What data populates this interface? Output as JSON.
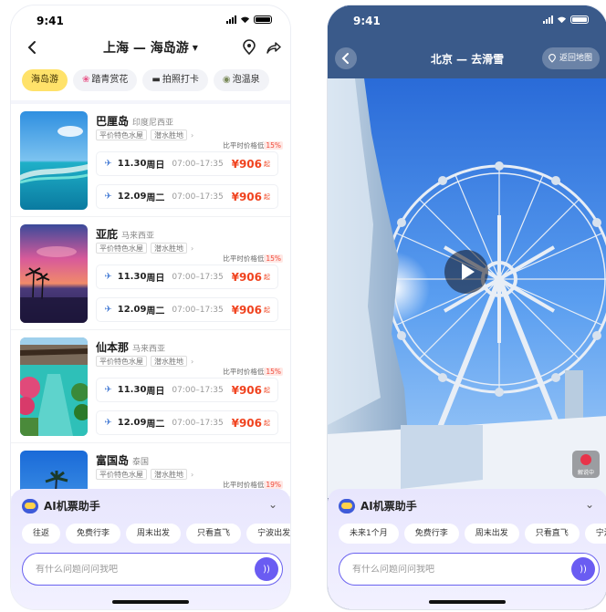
{
  "status_time": "9:41",
  "left": {
    "title": "上海 — 海岛游",
    "tags": [
      {
        "label": "海岛游",
        "icon": ""
      },
      {
        "label": "踏青赏花",
        "icon": "❀"
      },
      {
        "label": "拍照打卡",
        "icon": "▬"
      },
      {
        "label": "泡温泉",
        "icon": "◉"
      }
    ],
    "destinations": [
      {
        "name": "巴厘岛",
        "country": "印度尼西亚",
        "chips": [
          "平价特色水屋",
          "潜水胜地"
        ],
        "save": "比平时价格低",
        "save_pct": "15%",
        "flights": [
          {
            "date": "11.30",
            "weekday": "周日",
            "time": "07:00–17:35",
            "price": "¥906",
            "suffix": "起"
          },
          {
            "date": "12.09",
            "weekday": "周二",
            "time": "07:00–17:35",
            "price": "¥906",
            "suffix": "起"
          }
        ]
      },
      {
        "name": "亚庇",
        "country": "马来西亚",
        "chips": [
          "平价特色水屋",
          "潜水胜地"
        ],
        "save": "比平时价格低",
        "save_pct": "15%",
        "flights": [
          {
            "date": "11.30",
            "weekday": "周日",
            "time": "07:00–17:35",
            "price": "¥906",
            "suffix": "起"
          },
          {
            "date": "12.09",
            "weekday": "周二",
            "time": "07:00–17:35",
            "price": "¥906",
            "suffix": "起"
          }
        ]
      },
      {
        "name": "仙本那",
        "country": "马来西亚",
        "chips": [
          "平价特色水屋",
          "潜水胜地"
        ],
        "save": "比平时价格低",
        "save_pct": "15%",
        "flights": [
          {
            "date": "11.30",
            "weekday": "周日",
            "time": "07:00–17:35",
            "price": "¥906",
            "suffix": "起"
          },
          {
            "date": "12.09",
            "weekday": "周二",
            "time": "07:00–17:35",
            "price": "¥906",
            "suffix": "起"
          }
        ]
      },
      {
        "name": "富国岛",
        "country": "泰国",
        "chips": [
          "平价特色水屋",
          "潜水胜地"
        ],
        "save": "比平时价格低",
        "save_pct": "19%"
      }
    ],
    "assistant": {
      "title": "AI机票助手",
      "suggestions": [
        "往返",
        "免费行李",
        "周末出发",
        "只看直飞",
        "宁波出发"
      ],
      "placeholder": "有什么问题问问我吧"
    }
  },
  "right": {
    "title": "北京 — 去滑雪",
    "return_label": "返回地图",
    "narration_label": "解说中",
    "assistant": {
      "title": "AI机票助手",
      "suggestions": [
        "未来1个月",
        "免费行李",
        "周末出发",
        "只看直飞",
        "宁波出发"
      ],
      "placeholder": "有什么问题问问我吧"
    }
  },
  "colors": {
    "accent": "#6a5cf2",
    "price": "#f0431f",
    "tag_active": "#ffe26a"
  },
  "icons": [
    "back-arrow-icon",
    "location-pin-icon",
    "share-icon",
    "plane-icon",
    "chevron-down-icon",
    "voice-icon",
    "play-icon"
  ]
}
